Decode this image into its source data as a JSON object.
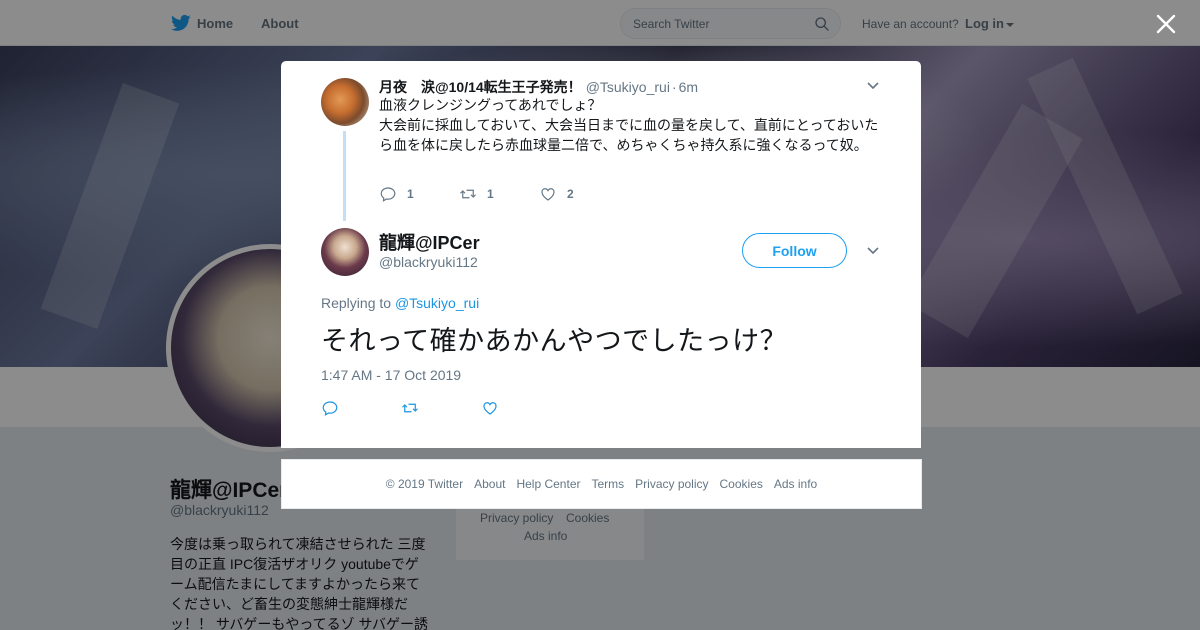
{
  "topnav": {
    "home_label": "Home",
    "about_label": "About",
    "search_placeholder": "Search Twitter",
    "have_account": "Have an account?",
    "login_label": "Log in"
  },
  "profile": {
    "name": "龍輝@IPCer",
    "handle": "@blackryuki112",
    "bio": "今度は乗っ取られて凍結させられた 三度目の正直 IPC復活ザオリク youtubeでゲーム配信たまにしてますよかったら来てください、ど畜生の変態紳士龍輝様だッ！！ サバゲーもやってるゾ サバゲー誘",
    "side_links": [
      "Privacy policy",
      "Cookies",
      "Ads info"
    ]
  },
  "parent_tweet": {
    "name": "月夜　涙@10/14転生王子発売！",
    "handle": "@Tsukiyo_rui",
    "time": "6m",
    "text_lines": [
      "血液クレンジングってあれでしょ？",
      "大会前に採血しておいて、大会当日までに血の量を戻して、直前にとっておいたら血を体に戻したら赤血球量二倍で、めちゃくちゃ持久系に強くなるって奴。"
    ],
    "reply_count": "1",
    "retweet_count": "1",
    "like_count": "2"
  },
  "main_tweet": {
    "name": "龍輝@IPCer",
    "handle": "@blackryuki112",
    "follow_label": "Follow",
    "replying_to_label": "Replying to",
    "replying_to_handle": "@Tsukiyo_rui",
    "text": "それって確かあかんやつでしたっけ？",
    "timestamp": "1:47 AM - 17 Oct 2019"
  },
  "footer": {
    "links": [
      "© 2019 Twitter",
      "About",
      "Help Center",
      "Terms",
      "Privacy policy",
      "Cookies",
      "Ads info"
    ]
  },
  "colors": {
    "accent": "#1da1f2",
    "link": "#1b95e0",
    "muted": "#657786",
    "thread_line": "#c4dff4"
  },
  "icons": [
    "twitter-bird-icon",
    "search-icon",
    "chevron-down-icon",
    "close-icon",
    "reply-icon",
    "retweet-icon",
    "like-icon"
  ]
}
